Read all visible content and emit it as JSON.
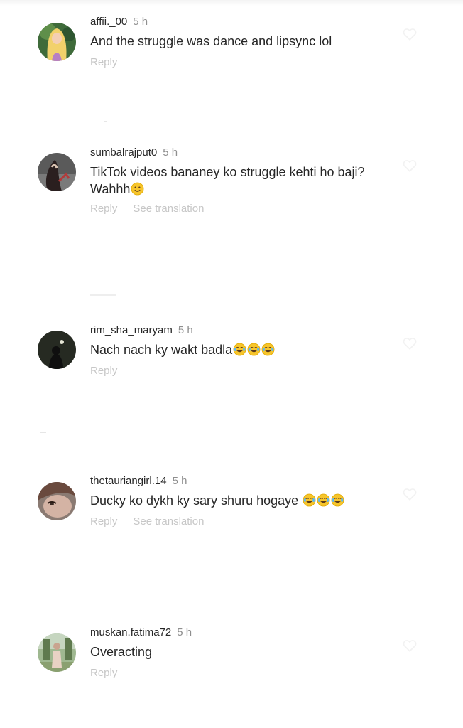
{
  "comments": [
    {
      "username": "affii._00",
      "time": "5 h",
      "text": "And the struggle was dance and lipsync lol",
      "emojis": [],
      "reply_label": "Reply",
      "translation_label": ""
    },
    {
      "username": "sumbalrajput0",
      "time": "5 h",
      "text": "TikTok videos bananey ko struggle kehti ho baji? Wahhh",
      "emojis": [
        "slightly-smiling-face"
      ],
      "reply_label": "Reply",
      "translation_label": "See translation"
    },
    {
      "username": "rim_sha_maryam",
      "time": "5 h",
      "text": "Nach nach ky wakt badla",
      "emojis": [
        "tears-of-joy",
        "tears-of-joy",
        "tears-of-joy"
      ],
      "reply_label": "Reply",
      "translation_label": ""
    },
    {
      "username": "thetauriangirl.14",
      "time": "5 h",
      "text": "Ducky ko dykh ky sary shuru hogaye ",
      "emojis": [
        "tears-of-joy",
        "tears-of-joy",
        "tears-of-joy"
      ],
      "reply_label": "Reply",
      "translation_label": "See translation"
    },
    {
      "username": "muskan.fatima72",
      "time": "5 h",
      "text": "Overacting",
      "emojis": [],
      "reply_label": "Reply",
      "translation_label": ""
    }
  ],
  "icons": {
    "like": "heart-outline-icon",
    "emoji_smile": "slightly-smiling-face-icon",
    "emoji_laugh": "face-with-tears-of-joy-icon"
  },
  "colors": {
    "text": "#262626",
    "muted": "#8e8e8e",
    "action": "#c7c7c7",
    "emoji_yellow": "#f7c52b"
  }
}
